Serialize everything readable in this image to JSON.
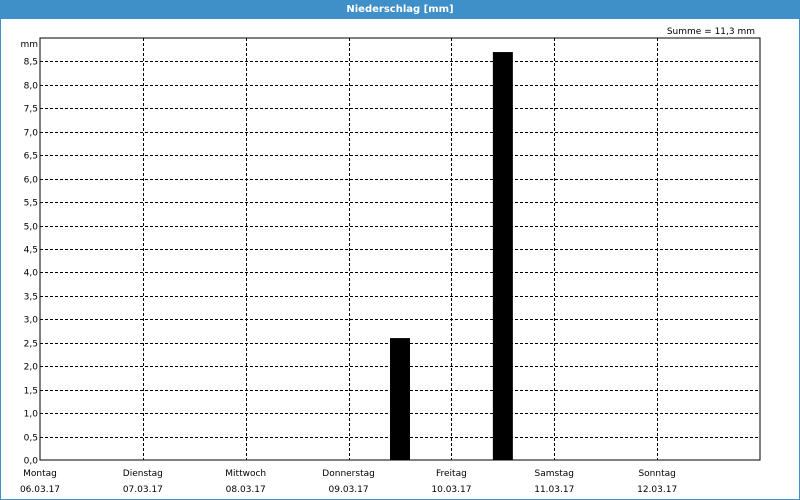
{
  "window": {
    "title": "Niederschlag [mm]"
  },
  "summary": {
    "label": "Summe = 11,3 mm"
  },
  "chart_data": {
    "type": "bar",
    "title": "Niederschlag [mm]",
    "ylabel": "mm",
    "xlabel": "",
    "ylim": [
      0,
      9.0
    ],
    "yticks": [
      {
        "value": 0.0,
        "label": "0,0"
      },
      {
        "value": 0.5,
        "label": "0,5"
      },
      {
        "value": 1.0,
        "label": "1,0"
      },
      {
        "value": 1.5,
        "label": "1,5"
      },
      {
        "value": 2.0,
        "label": "2,0"
      },
      {
        "value": 2.5,
        "label": "2,5"
      },
      {
        "value": 3.0,
        "label": "3,0"
      },
      {
        "value": 3.5,
        "label": "3,5"
      },
      {
        "value": 4.0,
        "label": "4,0"
      },
      {
        "value": 4.5,
        "label": "4,5"
      },
      {
        "value": 5.0,
        "label": "5,0"
      },
      {
        "value": 5.5,
        "label": "5,5"
      },
      {
        "value": 6.0,
        "label": "6,0"
      },
      {
        "value": 6.5,
        "label": "6,5"
      },
      {
        "value": 7.0,
        "label": "7,0"
      },
      {
        "value": 7.5,
        "label": "7,5"
      },
      {
        "value": 8.0,
        "label": "8,0"
      },
      {
        "value": 8.5,
        "label": "8,5"
      }
    ],
    "days": [
      {
        "day": "Montag",
        "date": "06.03.17"
      },
      {
        "day": "Dienstag",
        "date": "07.03.17"
      },
      {
        "day": "Mittwoch",
        "date": "08.03.17"
      },
      {
        "day": "Donnerstag",
        "date": "09.03.17"
      },
      {
        "day": "Freitag",
        "date": "10.03.17"
      },
      {
        "day": "Samstag",
        "date": "11.03.17"
      },
      {
        "day": "Sonntag",
        "date": "12.03.17"
      }
    ],
    "bars": [
      {
        "day_index": 3,
        "value": 2.6
      },
      {
        "day_index": 4,
        "value": 8.7
      }
    ],
    "bar_color": "#000000",
    "grid": true,
    "grid_style": "dashed"
  }
}
